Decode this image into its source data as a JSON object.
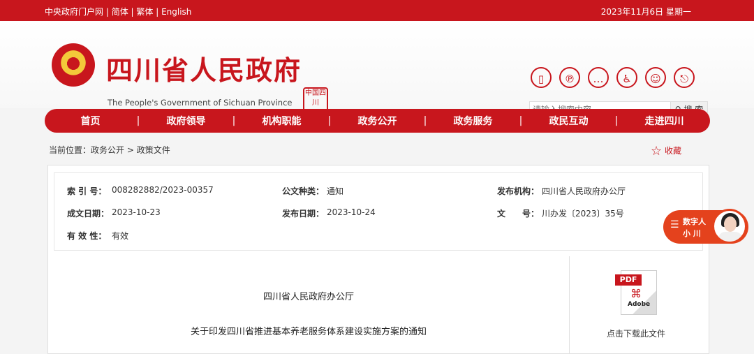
{
  "topbar": {
    "links": [
      "中央政府门户网",
      "简体",
      "繁体",
      "English"
    ],
    "date": "2023年11月6日 星期一"
  },
  "header": {
    "title": "四川省人民政府",
    "subtitle": "The People's Government of Sichuan Province",
    "seal_text": "中国四川",
    "icons": [
      "mobile-icon",
      "weibo-icon",
      "chat-icon",
      "accessibility-icon",
      "elderly-mode-icon",
      "exit-icon"
    ]
  },
  "search": {
    "placeholder": "请输入搜索内容",
    "button": "搜 索"
  },
  "nav": {
    "items": [
      "首页",
      "政府领导",
      "机构职能",
      "政务公开",
      "政务服务",
      "政民互动",
      "走进四川"
    ]
  },
  "breadcrumb": {
    "prefix": "当前位置：",
    "path": "政务公开 > 政策文件"
  },
  "favorite": {
    "label": "收藏"
  },
  "meta": {
    "index_label": "索 引 号：",
    "index_value": "008282882/2023-00357",
    "type_label": "公文种类：",
    "type_value": "通知",
    "agency_label": "发布机构：",
    "agency_value": "四川省人民政府办公厅",
    "created_label": "成文日期：",
    "created_value": "2023-10-23",
    "published_label": "发布日期：",
    "published_value": "2023-10-24",
    "docno_label": "文　　号：",
    "docno_value": "川办发〔2023〕35号",
    "validity_label": "有 效 性：",
    "validity_value": "有效"
  },
  "document": {
    "org": "四川省人民政府办公厅",
    "title": "关于印发四川省推进基本养老服务体系建设实施方案的通知"
  },
  "pdf": {
    "tag": "PDF",
    "brand": "Adobe",
    "download_label": "点击下载此文件"
  },
  "assistant": {
    "line1": "数字人",
    "line2": "小 川"
  }
}
